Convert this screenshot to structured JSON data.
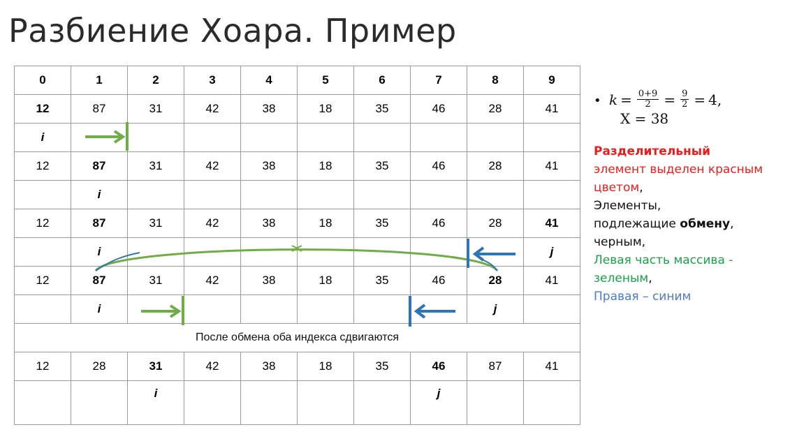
{
  "title": "Разбиение Хоара. Пример",
  "header": [
    "0",
    "1",
    "2",
    "3",
    "4",
    "5",
    "6",
    "7",
    "8",
    "9"
  ],
  "rows": {
    "r1": [
      "12",
      "87",
      "31",
      "42",
      "38",
      "18",
      "35",
      "46",
      "28",
      "41"
    ],
    "r3": [
      "12",
      "87",
      "31",
      "42",
      "38",
      "18",
      "35",
      "46",
      "28",
      "41"
    ],
    "r5": [
      "12",
      "87",
      "31",
      "42",
      "38",
      "18",
      "35",
      "46",
      "28",
      "41"
    ],
    "r7": [
      "12",
      "87",
      "31",
      "42",
      "38",
      "18",
      "35",
      "46",
      "28",
      "41"
    ],
    "r10": [
      "12",
      "28",
      "31",
      "42",
      "38",
      "18",
      "35",
      "46",
      "87",
      "41"
    ]
  },
  "markers": {
    "i": "i",
    "j": "j"
  },
  "note": "После обмена оба индекса сдвигаются",
  "formula": {
    "k": "k",
    "eq": "=",
    "frac1_num": "0+9",
    "frac1_den": "2",
    "frac2_num": "9",
    "frac2_den": "2",
    "k_value": "4,",
    "x_line": "X = 38"
  },
  "legend": {
    "bold_red": "Разделительный",
    "red_rest": "элемент выделен красным цветом",
    "comma1": ",",
    "line_elements": "Элементы,",
    "line_swap_pre": "подлежащие",
    "line_swap_bold": "обмену",
    "comma2": ",",
    "line_black": "черным,",
    "green_text": "Левая часть массива - зеленым",
    "comma3": ",",
    "blue_text": "Правая – синим"
  },
  "colors": {
    "green": "#3f8e2b",
    "red": "#ee1b1b",
    "blue": "#1515e6",
    "arrow_green": "#70ad47",
    "arrow_blue": "#2e75b6",
    "legend_green": "#17a34a",
    "legend_blue": "#4c7cc7"
  }
}
